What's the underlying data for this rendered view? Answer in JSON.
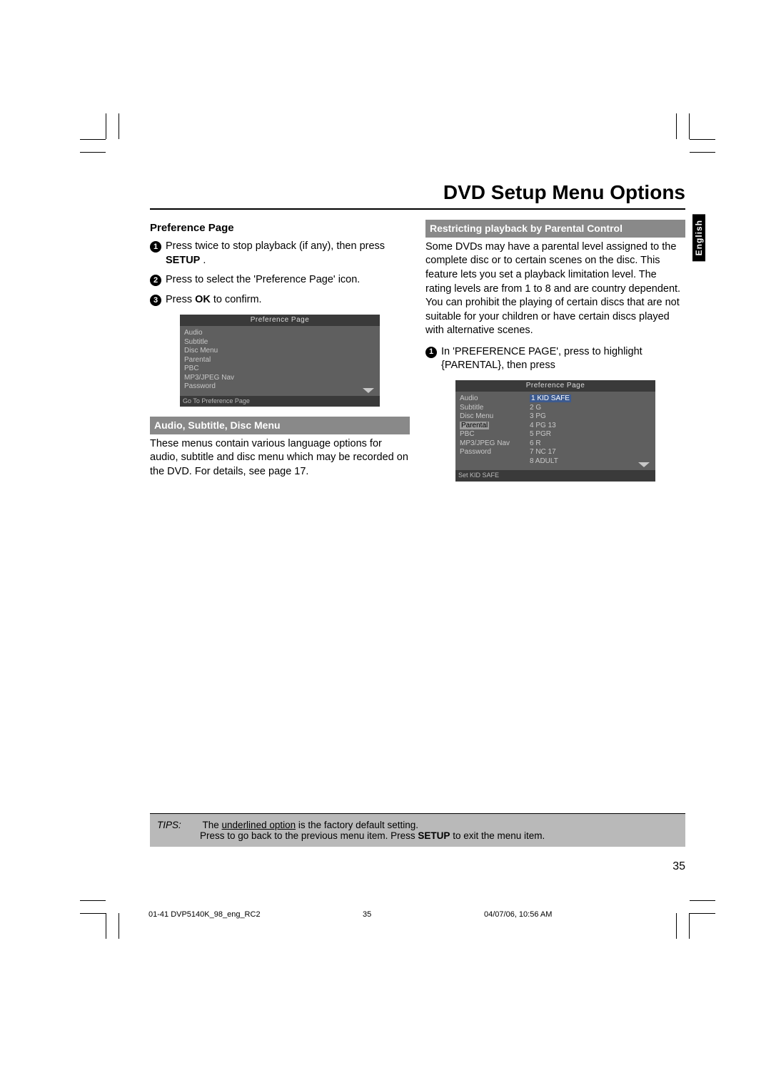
{
  "title": "DVD Setup Menu Options",
  "lang_tab": "English",
  "left": {
    "heading": "Preference Page",
    "step1a": "Press ",
    "step1b": " twice to stop playback (if any), then press ",
    "step1c": "SETUP",
    "step1d": ".",
    "step2a": "Press ",
    "step2b": " to select the 'Preference Page' icon.",
    "step3a": "Press ",
    "step3b": "OK",
    "step3c": " to confirm.",
    "menu_title": "Preference Page",
    "menu_items": [
      "Audio",
      "Subtitle",
      "Disc Menu",
      "Parental",
      "PBC",
      "MP3/JPEG Nav",
      "Password"
    ],
    "menu_foot": "Go To Preference Page",
    "sect": "Audio, Subtitle, Disc Menu",
    "para": "These menus contain various language options for audio, subtitle and disc menu which may be recorded on the DVD.  For details, see page 17."
  },
  "right": {
    "sect": "Restricting playback by Parental Control",
    "para": "Some DVDs may have a parental level assigned to the complete disc or to certain scenes on the disc. This feature lets you set a playback limitation level. The rating levels are from 1 to 8 and are country dependent. You can prohibit the playing of certain discs that are not suitable for your children or have certain discs played with alternative scenes.",
    "step1a": "In 'PREFERENCE PAGE', press ",
    "step1b": " to highlight {PARENTAL}, then press ",
    "menu_title": "Preference Page",
    "menu_items_left": [
      "Audio",
      "Subtitle",
      "Disc Menu",
      "Parental",
      "PBC",
      "MP3/JPEG Nav",
      "Password"
    ],
    "menu_items_right": [
      "1 KID SAFE",
      "2 G",
      "3 PG",
      "4 PG 13",
      "5 PGR",
      "6 R",
      "7 NC 17",
      "8 ADULT"
    ],
    "menu_foot": "Set KID SAFE"
  },
  "tips": {
    "label": "TIPS:",
    "line1a": "The ",
    "line1b": "underlined option",
    "line1c": " is the factory default setting.",
    "line2a": "Press ",
    "line2b": " to go back to the previous menu item.  Press ",
    "line2c": "SETUP",
    "line2d": " to exit the menu item."
  },
  "page_number": "35",
  "footer": {
    "file": "01-41 DVP5140K_98_eng_RC2",
    "page": "35",
    "date": "04/07/06, 10:56 AM"
  }
}
